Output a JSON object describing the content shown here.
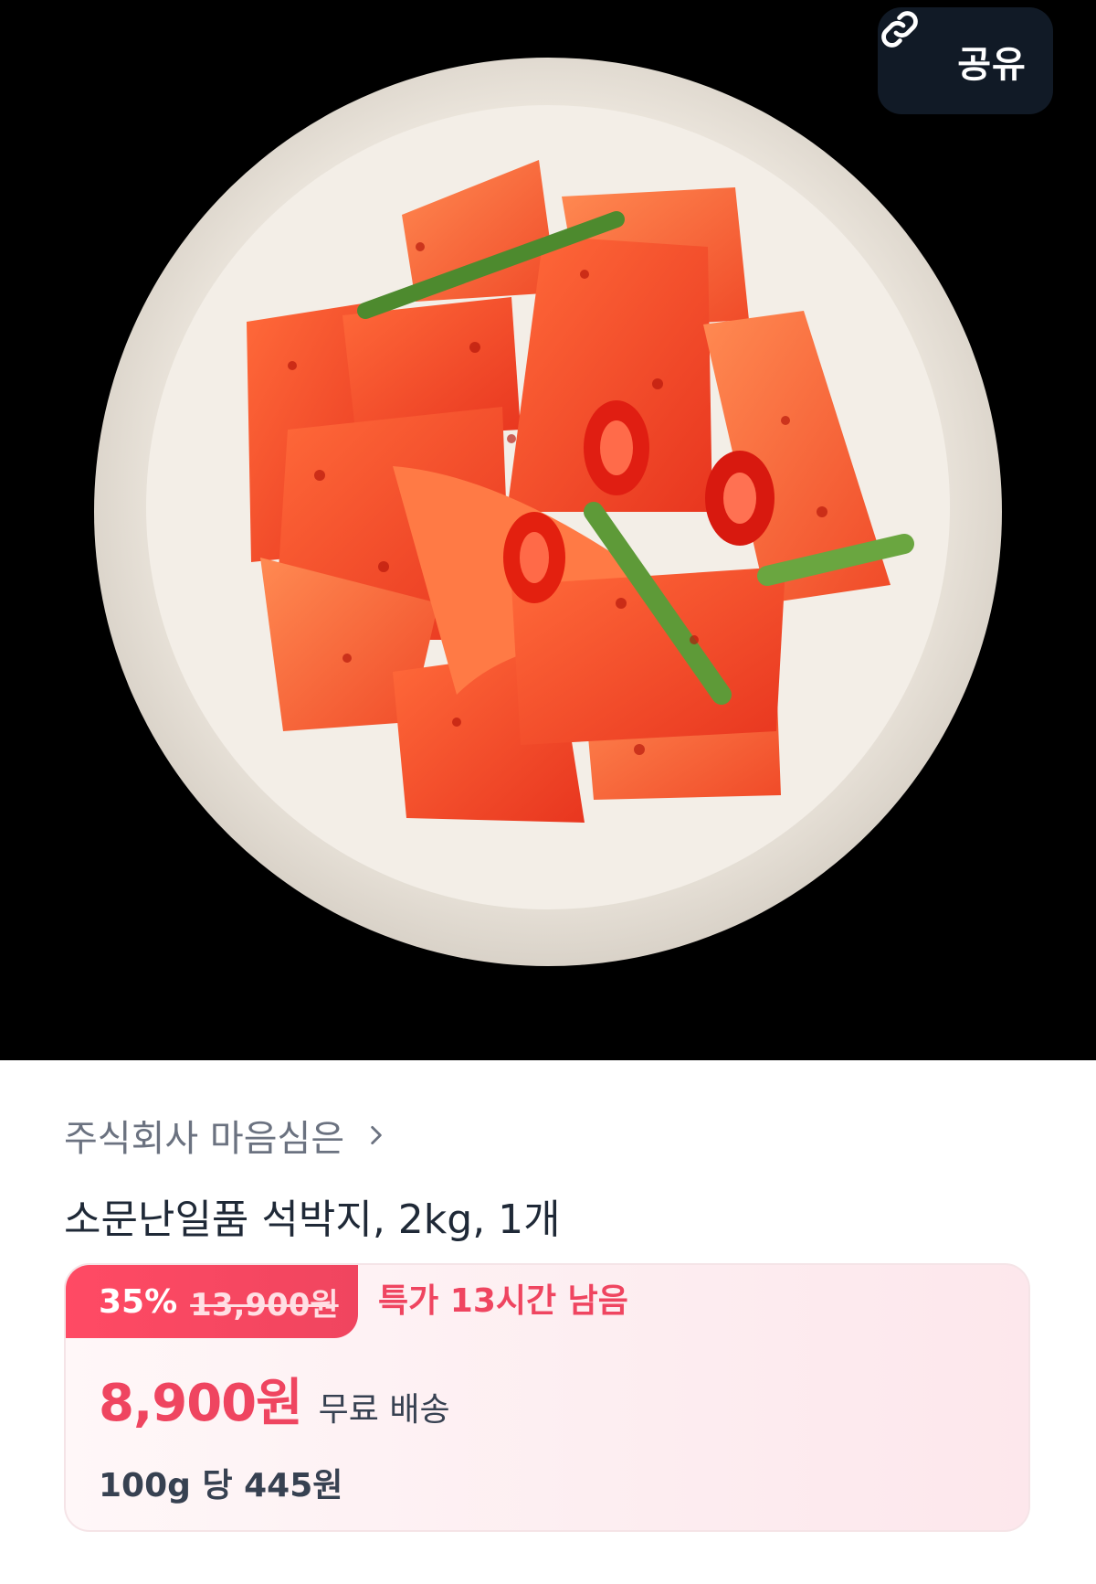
{
  "share_button": {
    "label": "공유",
    "icon": "link-icon"
  },
  "product_image": {
    "description_icon": "product-photo"
  },
  "seller": {
    "name": "주식회사 마음심은",
    "icon": "chevron-right-icon"
  },
  "product": {
    "title": "소문난일품 석박지, 2kg, 1개"
  },
  "price_card": {
    "discount_percent": "35%",
    "original_price": "13,900원",
    "deal_timer": "특가 13시간 남음",
    "sale_price": "8,900원",
    "shipping": "무료 배송",
    "unit_price": "100g 당 445원"
  },
  "colors": {
    "accent": "#ef4560",
    "hero_background": "#000000",
    "share_button_bg": "#111a26",
    "muted_text": "#6b7280"
  }
}
